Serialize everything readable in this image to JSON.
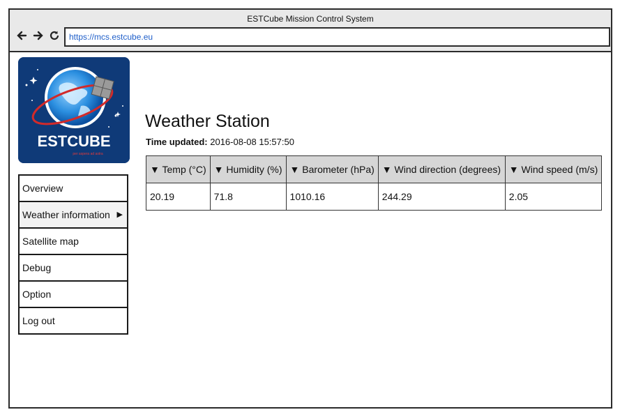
{
  "window": {
    "title": "ESTCube Mission Control System",
    "url": "https://mcs.estcube.eu"
  },
  "logo": {
    "text": "ESTCUBE",
    "motto": "per aspera ad astra"
  },
  "menu": {
    "items": [
      {
        "label": "Overview"
      },
      {
        "label": "Weather information",
        "indicator": "▶"
      },
      {
        "label": "Satellite map"
      },
      {
        "label": "Debug"
      },
      {
        "label": "Option"
      },
      {
        "label": "Log out"
      }
    ]
  },
  "main": {
    "title": "Weather Station",
    "updated_label": "Time updated:",
    "updated_value": "2016-08-08 15:57:50",
    "table": {
      "sort_marker": "▼",
      "headers": [
        "Temp (°C)",
        "Humidity (%)",
        "Barometer (hPa)",
        "Wind direction (degrees)",
        "Wind speed (m/s)"
      ],
      "row": [
        "20.19",
        "71.8",
        "1010.16",
        "244.29",
        "2.05"
      ]
    }
  }
}
